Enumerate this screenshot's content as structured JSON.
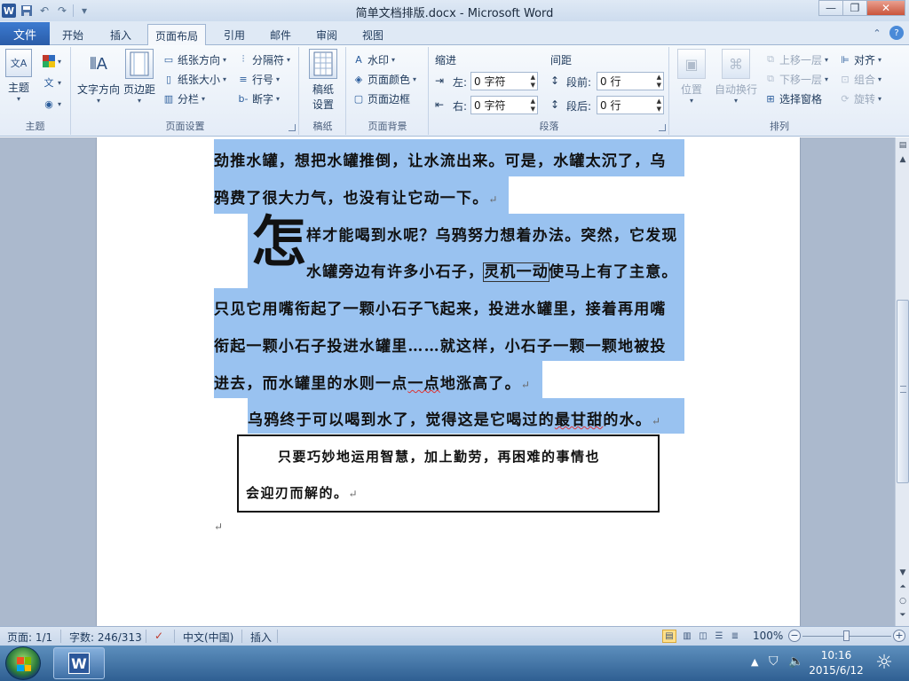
{
  "window": {
    "title": "简单文档排版.docx - Microsoft Word",
    "minimize": "—",
    "restore": "❐",
    "close": "✕"
  },
  "tabs": {
    "file": "文件",
    "items": [
      "开始",
      "插入",
      "页面布局",
      "引用",
      "邮件",
      "审阅",
      "视图"
    ],
    "active": "页面布局"
  },
  "ribbon": {
    "themes": {
      "label": "主题",
      "themes_button": "主题"
    },
    "page_setup": {
      "label": "页面设置",
      "text_direction": "文字方向",
      "margins": "页边距",
      "orientation": "纸张方向",
      "size": "纸张大小",
      "columns": "分栏",
      "breaks": "分隔符",
      "line_numbers": "行号",
      "hyphenation": "断字"
    },
    "manuscript": {
      "label": "稿纸",
      "button": "稿纸\n设置",
      "button_line1": "稿纸",
      "button_line2": "设置"
    },
    "page_background": {
      "label": "页面背景",
      "watermark": "水印",
      "page_color": "页面颜色",
      "page_borders": "页面边框"
    },
    "paragraph": {
      "label": "段落",
      "indent_title": "缩进",
      "spacing_title": "间距",
      "left_label": "左:",
      "left_value": "0 字符",
      "right_label": "右:",
      "right_value": "0 字符",
      "before_label": "段前:",
      "before_value": "0 行",
      "after_label": "段后:",
      "after_value": "0 行"
    },
    "arrange": {
      "label": "排列",
      "position": "位置",
      "wrap_text": "自动换行",
      "bring_forward": "上移一层",
      "send_backward": "下移一层",
      "selection_pane": "选择窗格",
      "align": "对齐",
      "group": "组合",
      "rotate": "旋转"
    }
  },
  "document": {
    "lines": [
      "劲推水罐，想把水罐推倒，让水流出来。可是，水罐太沉了，乌",
      "鸦费了很大力气，也没有让它动一下。"
    ],
    "dropcap_char": "怎",
    "dropcap_line1": "样才能喝到水呢？乌鸦努力想着办法。突然，它发现",
    "dropcap_line2_a": "水罐旁边有许多小石子，",
    "dropcap_line2_framed": "灵机一动",
    "dropcap_line2_b": "使马上有了主意。",
    "para2_lines": [
      "只见它用嘴衔起了一颗小石子飞起来，投进水罐里，接着再用嘴",
      "衔起一颗小石子投进水罐里……就这样，小石子一颗一颗地被投"
    ],
    "para2_last_a": "进去，而水罐里的水则一点",
    "para2_last_squiggle": "一点",
    "para2_last_b": "地涨高了。",
    "para3_a": "乌鸦终于可以喝到水了，觉得这是它喝过的",
    "para3_squiggle": "最甘甜",
    "para3_b": "的水。",
    "quote_line1": "只要巧妙地运用智慧，加上勤劳，再困难的事情也",
    "quote_line2": "会迎刃而解的。",
    "paragraph_mark": "↵"
  },
  "statusbar": {
    "page": "页面: 1/1",
    "words": "字数: 246/313",
    "language": "中文(中国)",
    "mode": "插入",
    "zoom": "100%",
    "zoom_level_percent": 100
  },
  "taskbar": {
    "time": "10:16",
    "date": "2015/6/12"
  }
}
